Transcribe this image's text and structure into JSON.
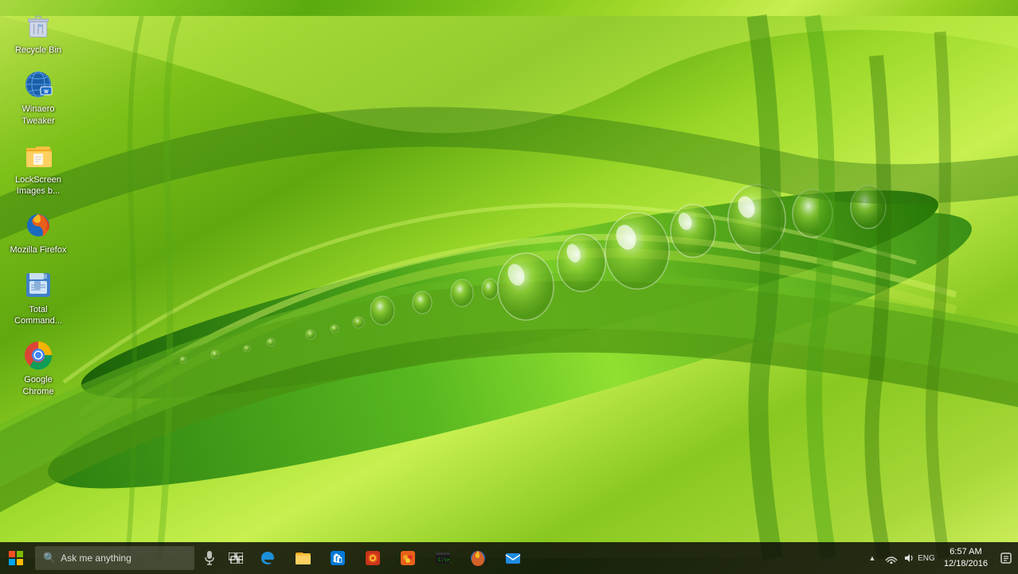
{
  "desktop": {
    "background_color": "#7bc220",
    "icons": [
      {
        "id": "recycle-bin",
        "label": "Recycle Bin",
        "icon_type": "recycle-bin"
      },
      {
        "id": "winaero-tweaker",
        "label": "Winaero Tweaker",
        "icon_type": "winaero"
      },
      {
        "id": "lockscreen-images",
        "label": "LockScreen Images b...",
        "icon_type": "folder"
      },
      {
        "id": "mozilla-firefox",
        "label": "Mozilla Firefox",
        "icon_type": "firefox"
      },
      {
        "id": "total-commander",
        "label": "Total Command...",
        "icon_type": "totalcmd"
      },
      {
        "id": "google-chrome",
        "label": "Google Chrome",
        "icon_type": "chrome"
      }
    ]
  },
  "taskbar": {
    "start_label": "⊞",
    "search_placeholder": "Ask me anything",
    "apps": [
      {
        "id": "edge",
        "label": "Microsoft Edge",
        "icon_type": "edge"
      },
      {
        "id": "file-explorer",
        "label": "File Explorer",
        "icon_type": "explorer"
      },
      {
        "id": "store",
        "label": "Store",
        "icon_type": "store"
      },
      {
        "id": "app5",
        "label": "App",
        "icon_type": "app5"
      },
      {
        "id": "app6",
        "label": "App",
        "icon_type": "app6"
      },
      {
        "id": "cmd",
        "label": "Command Prompt",
        "icon_type": "cmd"
      },
      {
        "id": "firefox-tb",
        "label": "Firefox",
        "icon_type": "firefox"
      },
      {
        "id": "mail",
        "label": "Mail",
        "icon_type": "mail"
      }
    ],
    "tray": {
      "show_hidden_label": "^",
      "icons": [
        "network",
        "speaker",
        "keyboard"
      ],
      "clock_time": "6:57 AM",
      "clock_date": "12/18/2016",
      "notification_label": "💬"
    }
  }
}
